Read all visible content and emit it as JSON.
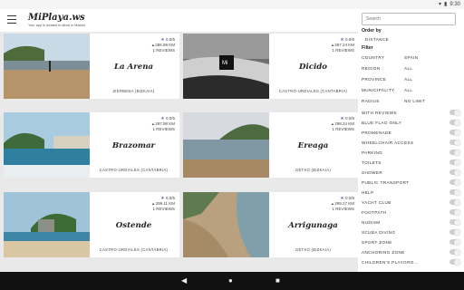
{
  "status": {
    "time": "9:30"
  },
  "app": {
    "title": "MiPlaya.ws",
    "subtitle": "Your app is located to allow in Madrid",
    "search_placeholder": "Search"
  },
  "beaches": [
    {
      "name": "La Arena",
      "rating": "0.0/5",
      "distance": "286.88 KM",
      "reviews": "1 REVIEWS",
      "location": "ZIERBENA (BIZKAIA)"
    },
    {
      "name": "Dicido",
      "rating": "0.0/5",
      "distance": "287.24 KM",
      "reviews": "1 REVIEWS",
      "location": "CASTRO-URDIALES (CANTABRIA)"
    },
    {
      "name": "Brazomar",
      "rating": "0.0/5",
      "distance": "297.98 KM",
      "reviews": "1 REVIEWS",
      "location": "CASTRO-URDIALES (CANTABRIA)"
    },
    {
      "name": "Ereaga",
      "rating": "0.0/5",
      "distance": "298.24 KM",
      "reviews": "1 REVIEWS",
      "location": "GETXO (BIZKAIA)"
    },
    {
      "name": "Ostende",
      "rating": "0.0/5",
      "distance": "299.11 KM",
      "reviews": "1 REVIEWS",
      "location": "CASTRO-URDIALES (CANTABRIA)"
    },
    {
      "name": "Arrigunaga",
      "rating": "0.0/5",
      "distance": "299.27 KM",
      "reviews": "1 REVIEWS",
      "location": "GETXO (BIZKAIA)"
    }
  ],
  "panel": {
    "order_label": "Order by",
    "order_value": "DISTANCE",
    "filter_label": "Filter",
    "selects": [
      {
        "label": "COUNTRY",
        "value": "SPAIN"
      },
      {
        "label": "REGION",
        "value": "ALL"
      },
      {
        "label": "PROVINCE",
        "value": "ALL"
      },
      {
        "label": "MUNICIPALITY",
        "value": "ALL"
      },
      {
        "label": "RADIUS",
        "value": "NO LIMIT"
      }
    ],
    "toggles": [
      "WITH REVIEWS",
      "BLUE FLAG ONLY",
      "PROMENADE",
      "WHEELCHAIR ACCESS",
      "PARKING",
      "TOILETS",
      "SHOWER",
      "PUBLIC TRANSPORT",
      "HELP",
      "YACHT CLUB",
      "FOOTPATH",
      "NUDISM",
      "SCUBA DIVING",
      "SPORT ZONE",
      "ANCHORING ZONE",
      "CHILDREN'S PLAYGRO..."
    ]
  },
  "icons": {
    "menu": "hamburger-icon",
    "back": "back-icon",
    "home": "home-icon",
    "recents": "recents-icon",
    "star": "star-icon"
  },
  "colors": {
    "star": "#7a5fc0",
    "navbar": "#111111"
  }
}
